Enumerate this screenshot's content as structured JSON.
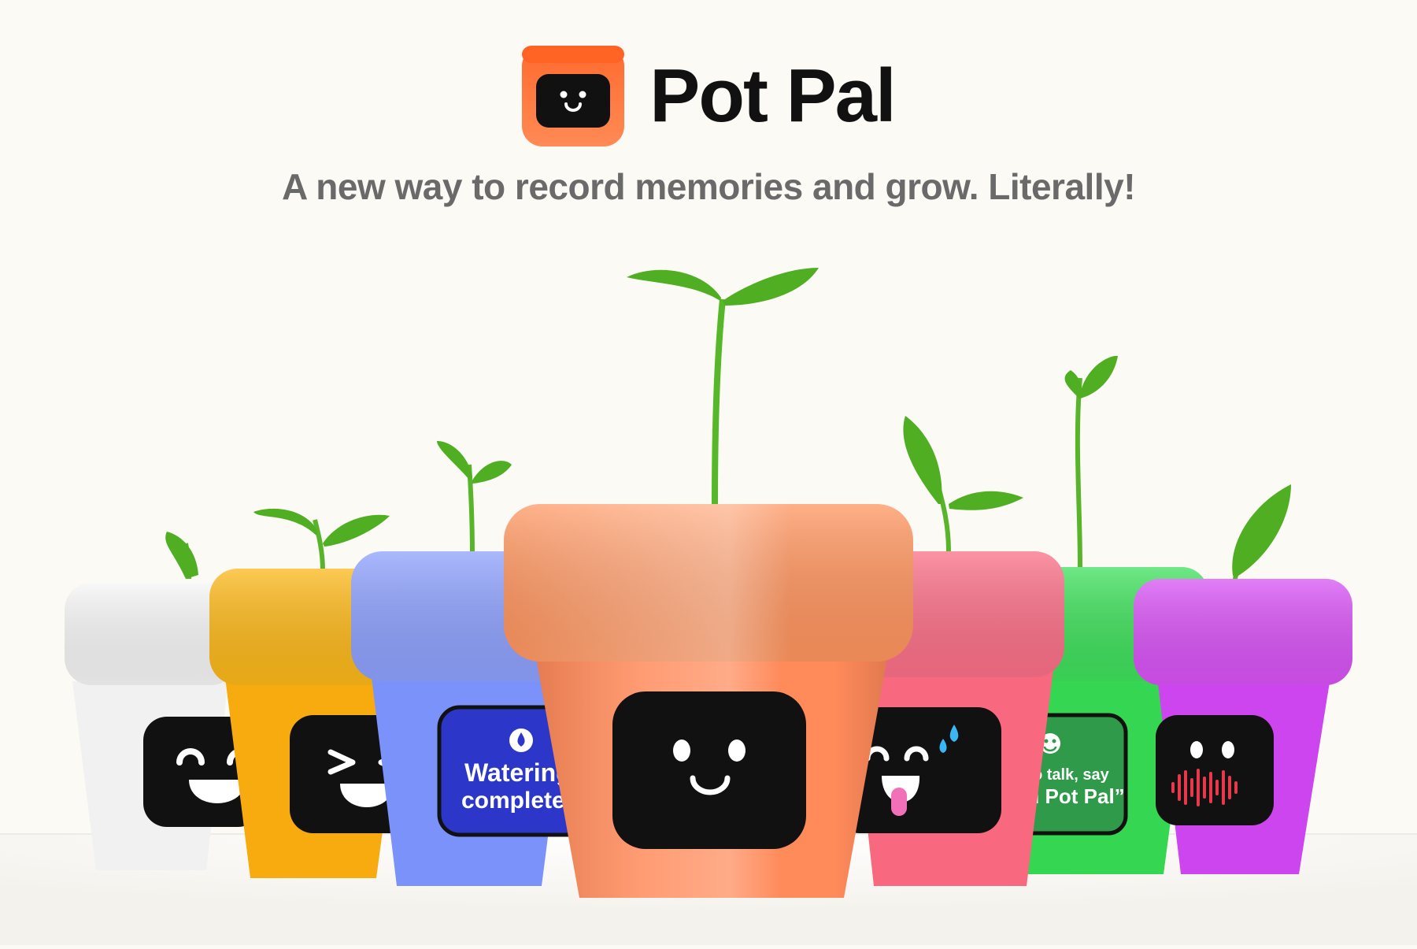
{
  "brand": {
    "name": "Pot Pal",
    "tagline": "A new way to record memories and grow. Literally!",
    "logo_icon": "smiling-screen-icon",
    "colors": {
      "logo_top": "#ff6a2e",
      "logo_bottom": "#ff8a55",
      "text": "#111111"
    }
  },
  "pots": [
    {
      "color": "white",
      "hex": "#f1f1f1",
      "screen": "laughing-face-icon"
    },
    {
      "color": "yellow",
      "hex": "#fbb413",
      "screen": "squinting-laugh-face-icon"
    },
    {
      "color": "blue",
      "hex": "#7f95fb",
      "screen": "watering-message",
      "screen_lines": [
        "Watering",
        "complete"
      ],
      "screen_icon": "water-drop-icon"
    },
    {
      "color": "orange",
      "hex": "#ff8c5c",
      "screen": "smiling-face-icon"
    },
    {
      "color": "pink",
      "hex": "#fb6f85",
      "screen": "sweating-tongue-face-icon"
    },
    {
      "color": "green",
      "hex": "#3fe05c",
      "screen": "voice-prompt-message",
      "screen_lines": [
        "To talk, say",
        "“Hi Pot Pal”"
      ],
      "screen_icon": "smile-icon"
    },
    {
      "color": "purple",
      "hex": "#d44ff2",
      "screen": "listening-face-icon",
      "screen_icon": "soundwave-icon"
    }
  ]
}
